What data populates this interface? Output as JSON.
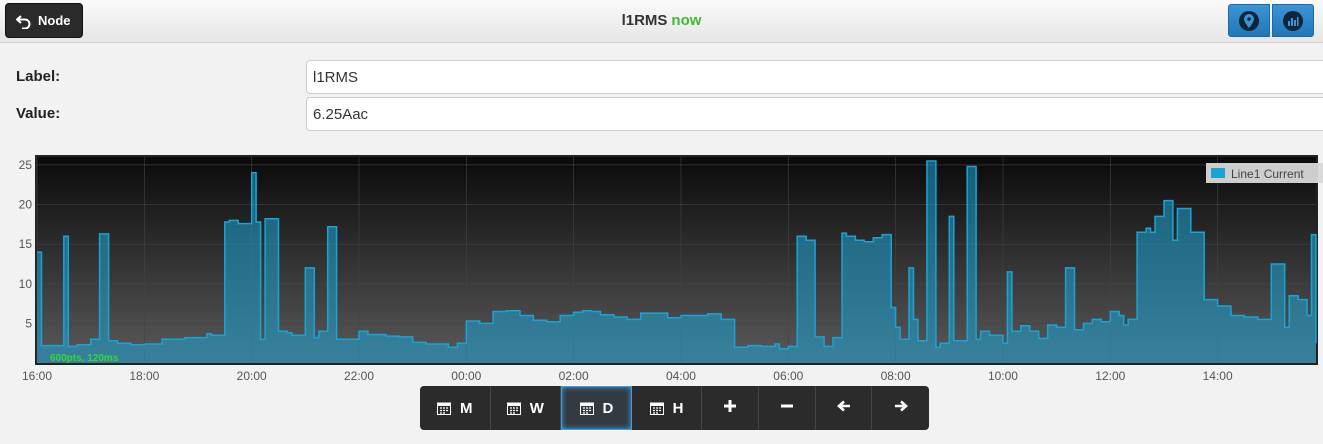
{
  "header": {
    "back_label": "Node",
    "title": "l1RMS",
    "status": "now"
  },
  "fields": {
    "label_caption": "Label:",
    "label_value": "l1RMS",
    "value_caption": "Value:",
    "value_value": "6.25Aac"
  },
  "chart_overlay": "600pts, 120ms",
  "toolbar": {
    "month": "M",
    "week": "W",
    "day": "D",
    "hour": "H",
    "active": "D"
  },
  "icons": {
    "back": "back-arrow-icon",
    "location": "map-marker-icon",
    "graph": "bar-chart-icon",
    "calendar": "calendar-icon",
    "zoom_in": "plus-icon",
    "zoom_out": "minus-icon",
    "left": "arrow-left-icon",
    "right": "arrow-right-icon"
  },
  "colors": {
    "series": "#1ba3d4",
    "status_now": "#3dbb2e",
    "overlay_text": "#36d636"
  },
  "chart_data": {
    "type": "area",
    "title": "",
    "xlabel": "",
    "ylabel": "",
    "xlim": [
      "16:00",
      "15:50"
    ],
    "ylim": [
      0,
      26
    ],
    "yticks": [
      5,
      10,
      15,
      20,
      25
    ],
    "xticks": [
      "16:00",
      "18:00",
      "20:00",
      "22:00",
      "00:00",
      "02:00",
      "04:00",
      "06:00",
      "08:00",
      "10:00",
      "12:00",
      "14:00"
    ],
    "grid": true,
    "legend": "top-right",
    "series": [
      {
        "name": "Line1 Current",
        "x": [
          "16:00",
          "16:05",
          "16:10",
          "16:30",
          "16:35",
          "16:45",
          "17:00",
          "17:10",
          "17:20",
          "17:30",
          "17:45",
          "18:00",
          "18:20",
          "18:45",
          "19:10",
          "19:15",
          "19:30",
          "19:35",
          "19:45",
          "20:00",
          "20:05",
          "20:10",
          "20:15",
          "20:30",
          "20:40",
          "20:45",
          "21:00",
          "21:10",
          "21:15",
          "21:25",
          "21:35",
          "22:00",
          "22:10",
          "22:30",
          "22:45",
          "23:00",
          "23:15",
          "23:40",
          "23:50",
          "00:00",
          "00:15",
          "00:30",
          "00:45",
          "01:00",
          "01:15",
          "01:30",
          "01:45",
          "02:00",
          "02:10",
          "02:20",
          "02:30",
          "02:45",
          "03:00",
          "03:15",
          "03:45",
          "04:00",
          "04:15",
          "04:30",
          "04:45",
          "05:00",
          "05:15",
          "05:30",
          "05:45",
          "05:50",
          "06:00",
          "06:10",
          "06:20",
          "06:30",
          "06:40",
          "06:50",
          "07:00",
          "07:05",
          "07:15",
          "07:25",
          "07:35",
          "07:45",
          "07:55",
          "08:00",
          "08:05",
          "08:15",
          "08:20",
          "08:25",
          "08:35",
          "08:45",
          "08:50",
          "09:00",
          "09:05",
          "09:20",
          "09:30",
          "09:35",
          "09:45",
          "10:00",
          "10:05",
          "10:10",
          "10:20",
          "10:30",
          "10:40",
          "10:50",
          "11:00",
          "11:10",
          "11:20",
          "11:30",
          "11:40",
          "11:50",
          "12:00",
          "12:10",
          "12:15",
          "12:20",
          "12:30",
          "12:40",
          "12:45",
          "12:50",
          "13:00",
          "13:10",
          "13:15",
          "13:30",
          "13:45",
          "14:00",
          "14:15",
          "14:30",
          "14:45",
          "15:00",
          "15:15",
          "15:20",
          "15:30",
          "15:40",
          "15:45",
          "15:50"
        ],
        "y": [
          14,
          2.2,
          2.2,
          16,
          2.1,
          2.3,
          3,
          16.3,
          2.8,
          2.5,
          2.3,
          2.4,
          3,
          3.2,
          3.7,
          3.5,
          17.8,
          18,
          17.6,
          24,
          17.8,
          3,
          18.2,
          4,
          3.8,
          3.5,
          12,
          3.2,
          4,
          17.2,
          3,
          4,
          3.6,
          3.4,
          3.3,
          2.6,
          2.4,
          2,
          2.5,
          5.3,
          5,
          6.5,
          6.6,
          6,
          5.4,
          5.2,
          6,
          6.4,
          6.6,
          6.5,
          6.1,
          5.8,
          5.5,
          6.3,
          5.7,
          6,
          6,
          6.2,
          5.5,
          2,
          2.2,
          2.1,
          2.4,
          1.8,
          2.1,
          16,
          15.5,
          3.3,
          2.1,
          3.2,
          16.4,
          16,
          15.5,
          15.3,
          15.8,
          16.2,
          7,
          4.5,
          3,
          12,
          5.5,
          2.8,
          25.5,
          2,
          2.5,
          18.5,
          2.8,
          24.8,
          3,
          4,
          3.5,
          2.5,
          11.5,
          4,
          4.7,
          4,
          3.1,
          4.8,
          4.5,
          12,
          4.2,
          5,
          5.5,
          5.2,
          6.5,
          6,
          4.8,
          5.5,
          16.5,
          17,
          16.5,
          18.5,
          20.5,
          15.5,
          19.5,
          16.5,
          8,
          7.2,
          6,
          5.8,
          5.5,
          12.5,
          4.5,
          8.5,
          8,
          6,
          16.2,
          2.5
        ]
      }
    ]
  }
}
